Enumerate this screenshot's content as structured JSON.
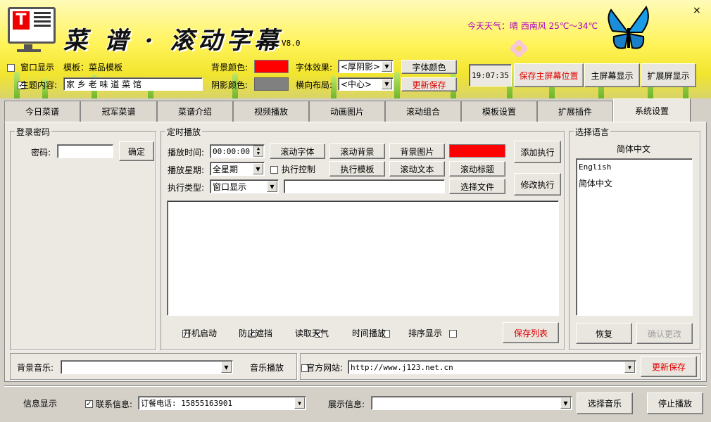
{
  "banner": {
    "title": "菜 谱 · 滚动字幕",
    "version": "V8.0",
    "weather": "今天天气：晴  西南风  25℃～34℃",
    "close": "×"
  },
  "top": {
    "window_display_label": "窗口显示",
    "template_label": "模板：菜品模板",
    "theme_label": "主题内容:",
    "theme_value": "家 乡 老 味 道 菜 馆",
    "bg_color_label": "背景颜色:",
    "shadow_color_label": "阴影颜色:",
    "font_effect_label": "字体效果:",
    "font_effect_value": "<厚阴影>",
    "horiz_layout_label": "横向布局:",
    "horiz_layout_value": "<中心>",
    "font_color_btn": "字体颜色",
    "update_save_btn": "更新保存",
    "time": "19:07:35",
    "save_main_pos_btn": "保存主屏幕位置",
    "main_display_btn": "主屏幕显示",
    "ext_display_btn": "扩展屏显示"
  },
  "tabs": [
    "今日菜谱",
    "冠军菜谱",
    "菜谱介绍",
    "视频播放",
    "动画图片",
    "滚动组合",
    "模板设置",
    "扩展插件",
    "系统设置"
  ],
  "login": {
    "group_title": "登录密码",
    "password_label": "密码:",
    "password_value": "",
    "confirm_btn": "确定"
  },
  "schedule": {
    "group_title": "定时播放",
    "time_label": "播放时间:",
    "time_value": "00:00:00",
    "week_label": "播放星期:",
    "week_value": "全星期",
    "exec_control_label": "执行控制",
    "type_label": "执行类型:",
    "type_value": "窗口显示",
    "path_value": "",
    "btn_scroll_font": "滚动字体",
    "btn_scroll_bg": "滚动背景",
    "btn_bg_image": "背景图片",
    "btn_exec_template": "执行模板",
    "btn_scroll_text": "滚动文本",
    "btn_scroll_title": "滚动标题",
    "btn_choose_file": "选择文件",
    "btn_add_exec": "添加执行",
    "btn_modify_exec": "修改执行",
    "opt_boot": "开机启动",
    "opt_prevent_block": "防止遮挡",
    "opt_read_weather": "读取天气",
    "opt_time_play": "时间播放",
    "opt_sort_display": "排序显示",
    "btn_save_list": "保存列表"
  },
  "language": {
    "group_title": "选择语言",
    "current": "简体中文",
    "options": [
      "English",
      "简体中文"
    ],
    "restore_btn": "恢复",
    "confirm_btn": "确认更改"
  },
  "music": {
    "label": "背景音乐:",
    "value": "",
    "play_label": "音乐播放"
  },
  "website": {
    "label": "官方网站:",
    "value": "http://www.j123.net.cn",
    "update_btn": "更新保存"
  },
  "footer": {
    "info_display_label": "信息显示",
    "contact_label": "联系信息:",
    "contact_value": "订餐电话: 15855163901",
    "show_info_label": "展示信息:",
    "show_info_value": "",
    "choose_music_btn": "选择音乐",
    "stop_play_btn": "停止播放"
  },
  "colors": {
    "bg_color": "#ff0000",
    "shadow_color": "#808080",
    "schedule_color": "#ff0000",
    "weather_text": "#b000c0",
    "red_text": "#e00000"
  }
}
